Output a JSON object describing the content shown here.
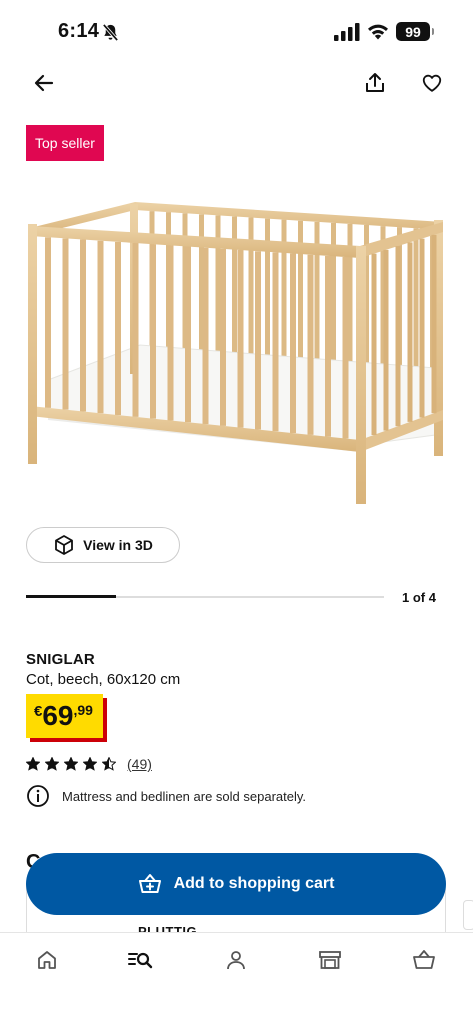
{
  "status_bar": {
    "time": "6:14",
    "battery": "99"
  },
  "product": {
    "badge": "Top seller",
    "view_3d_label": "View in 3D",
    "pager": "1 of 4",
    "progress": 0.25,
    "name": "SNIGLAR",
    "description": "Cot, beech, 60x120 cm",
    "price": {
      "currency": "€",
      "integer": "69",
      "decimal": ",99"
    },
    "rating": {
      "stars": 4.5,
      "count": "(49)"
    },
    "notice": "Mattress and bedlinen are sold separately."
  },
  "section": {
    "heading": "C",
    "card_label": "PLUTTIG"
  },
  "actions": {
    "add_to_cart": "Add to shopping cart"
  },
  "tabbar": [
    "home-icon",
    "search-icon",
    "profile-icon",
    "store-icon",
    "basket-icon"
  ],
  "colors": {
    "badge": "#e00751",
    "cart_button": "#0058a3",
    "price_tag": "#ffdb00",
    "price_shadow": "#cc0008"
  }
}
